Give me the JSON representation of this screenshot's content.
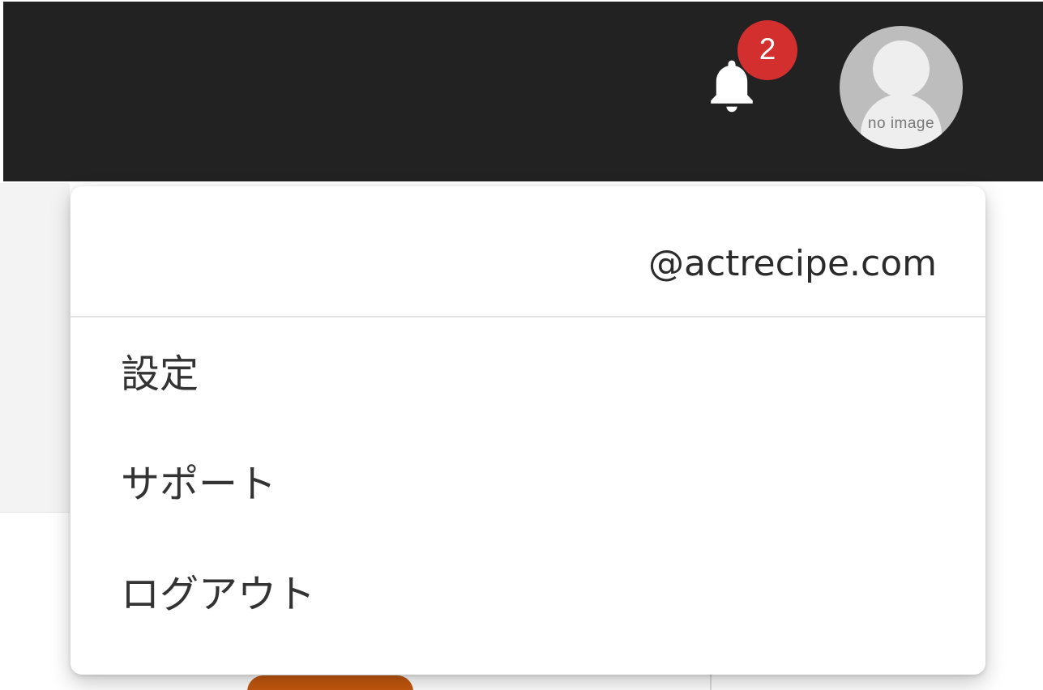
{
  "header": {
    "notifications": {
      "icon": "bell-icon",
      "badge_count": "2",
      "badge_color": "#d32f2f"
    },
    "avatar": {
      "icon": "user-avatar-placeholder",
      "placeholder_text": "no image"
    },
    "background_color": "#222222"
  },
  "account_menu": {
    "email": "@actrecipe.com",
    "items": [
      {
        "label": "設定"
      },
      {
        "label": "サポート"
      },
      {
        "label": "ログアウト"
      }
    ]
  },
  "accent_color": "#c4580e"
}
